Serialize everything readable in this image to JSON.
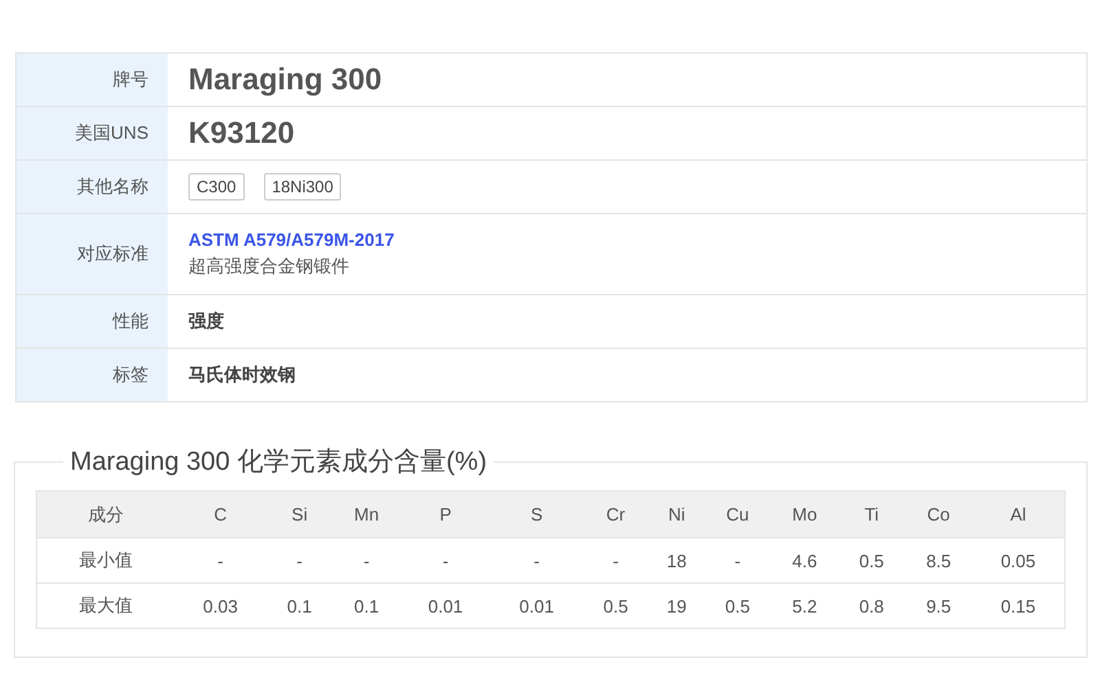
{
  "info": [
    {
      "label": "牌号",
      "kind": "title",
      "value": "Maraging 300"
    },
    {
      "label": "美国UNS",
      "kind": "title",
      "value": "K93120"
    },
    {
      "label": "其他名称",
      "kind": "tags",
      "tags": [
        "C300",
        "18Ni300"
      ]
    },
    {
      "label": "对应标准",
      "kind": "standard",
      "link": "ASTM A579/A579M-2017",
      "note": "超高强度合金钢锻件"
    },
    {
      "label": "性能",
      "kind": "bold",
      "value": "强度"
    },
    {
      "label": "标签",
      "kind": "bold",
      "value": "马氏体时效钢"
    }
  ],
  "composition": {
    "title": "Maraging 300 化学元素成分含量(%)",
    "columns": [
      "成分",
      "C",
      "Si",
      "Mn",
      "P",
      "S",
      "Cr",
      "Ni",
      "Cu",
      "Mo",
      "Ti",
      "Co",
      "Al"
    ],
    "rows": [
      [
        "最小值",
        "-",
        "-",
        "-",
        "-",
        "-",
        "-",
        "18",
        "-",
        "4.6",
        "0.5",
        "8.5",
        "0.05"
      ],
      [
        "最大值",
        "0.03",
        "0.1",
        "0.1",
        "0.01",
        "0.01",
        "0.5",
        "19",
        "0.5",
        "5.2",
        "0.8",
        "9.5",
        "0.15"
      ]
    ]
  }
}
